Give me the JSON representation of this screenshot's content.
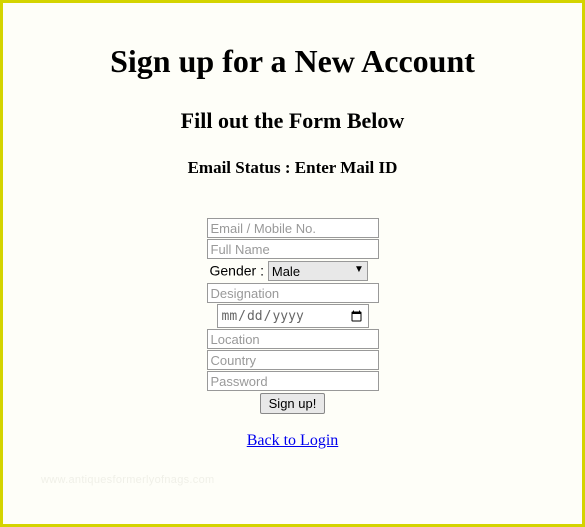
{
  "headings": {
    "title": "Sign up for a New Account",
    "subtitle": "Fill out the Form Below",
    "status": "Email Status : Enter Mail ID"
  },
  "fields": {
    "email_placeholder": "Email / Mobile No.",
    "fullname_placeholder": "Full Name",
    "gender_label": "Gender : ",
    "gender_selected": "Male",
    "designation_placeholder": "Designation",
    "date_placeholder": "mm/dd/yyyy",
    "location_placeholder": "Location",
    "country_placeholder": "Country",
    "password_placeholder": "Password"
  },
  "actions": {
    "signup_label": "Sign up!",
    "back_link": "Back to Login"
  },
  "watermark": "www.antiquesformerlyofnags.com"
}
